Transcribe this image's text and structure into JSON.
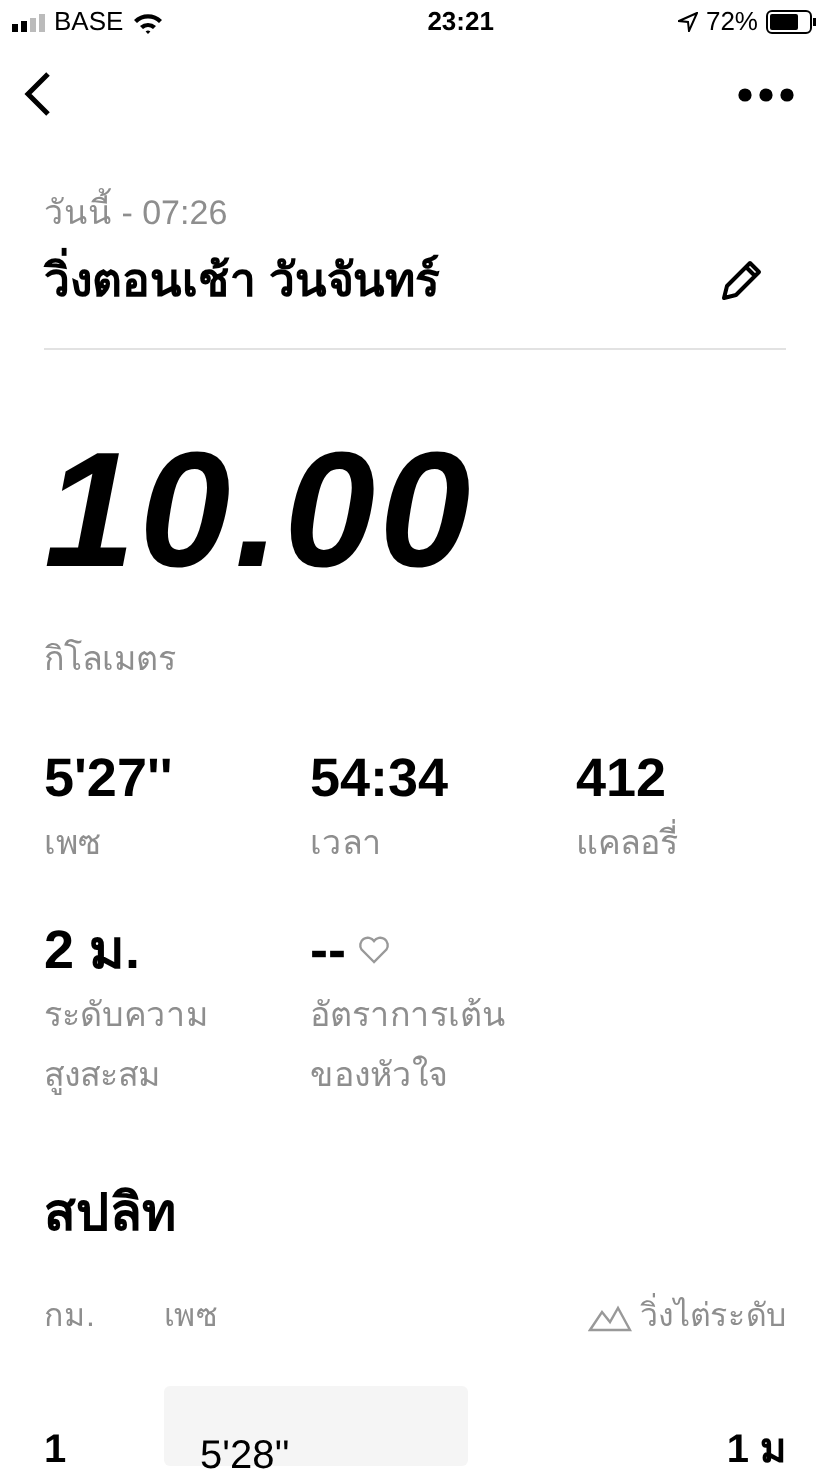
{
  "status_bar": {
    "carrier": "BASE",
    "time": "23:21",
    "battery": "72%"
  },
  "activity": {
    "date": "วันนี้ - 07:26",
    "title": "วิ่งตอนเช้า วันจันทร์"
  },
  "distance": {
    "value": "10.00",
    "unit": "กิโลเมตร"
  },
  "stats": [
    {
      "value": "5'27''",
      "label": "เพซ",
      "heart": false
    },
    {
      "value": "54:34",
      "label": "เวลา",
      "heart": false
    },
    {
      "value": "412",
      "label": "แคลอรี่",
      "heart": false
    },
    {
      "value": "2 ม.",
      "label": "ระดับความ\nสูงสะสม",
      "heart": false
    },
    {
      "value": "--",
      "label": "อัตราการเต้น\nของหัวใจ",
      "heart": true
    }
  ],
  "splits": {
    "title": "สปลิท",
    "columns": [
      "กม.",
      "เพซ",
      "วิ่งไต่ระดับ"
    ],
    "rows": [
      {
        "km": "1",
        "pace": "5'28''",
        "elevation": "1 ม"
      }
    ]
  }
}
